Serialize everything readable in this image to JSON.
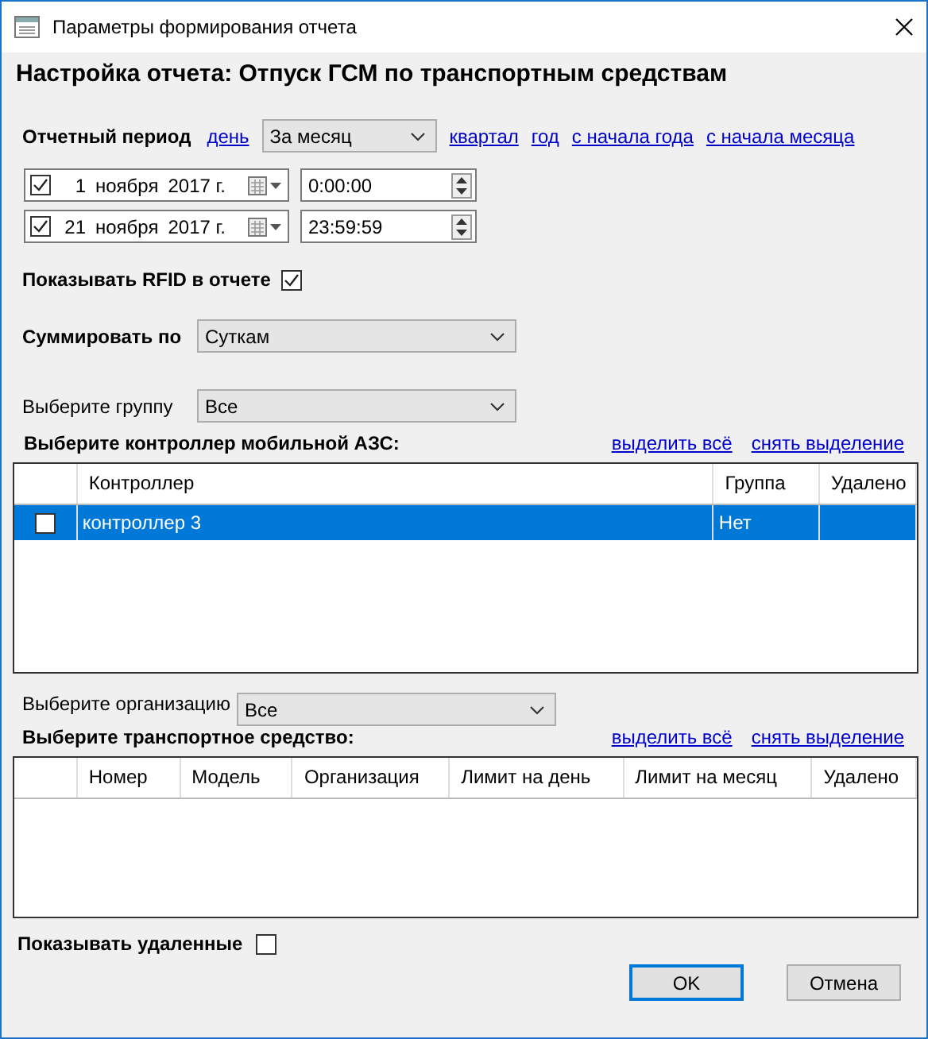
{
  "window": {
    "title": "Параметры формирования отчета"
  },
  "heading": "Настройка отчета: Отпуск ГСМ по транспортным средствам",
  "period": {
    "label": "Отчетный период",
    "items": [
      {
        "kind": "link",
        "label": "день"
      },
      {
        "kind": "select",
        "value": "За месяц"
      },
      {
        "kind": "link",
        "label": "квартал"
      },
      {
        "kind": "link",
        "label": "год"
      },
      {
        "kind": "link",
        "label": "с начала года"
      },
      {
        "kind": "link",
        "label": "с начала месяца"
      }
    ]
  },
  "dates": [
    {
      "checked": true,
      "day": "1",
      "month": "ноября",
      "year": "2017 г.",
      "time": "0:00:00"
    },
    {
      "checked": true,
      "day": "21",
      "month": "ноября",
      "year": "2017 г.",
      "time": "23:59:59"
    }
  ],
  "rfid": {
    "label": "Показывать RFID в отчете",
    "checked": true
  },
  "sum": {
    "label": "Суммировать по",
    "value": "Суткам"
  },
  "group": {
    "label": "Выберите группу",
    "value": "Все"
  },
  "controllers": {
    "label": "Выберите контроллер мобильной АЗС:",
    "actions": [
      "выделить всё",
      "снять выделение"
    ],
    "columns": [
      "Контроллер",
      "Группа",
      "Удалено"
    ],
    "rows": [
      {
        "checked": false,
        "selected": true,
        "controller": "контроллер 3",
        "group": "Нет"
      }
    ]
  },
  "organization": {
    "label": "Выберите организацию",
    "value": "Все"
  },
  "vehicles": {
    "label": "Выберите транспортное средство:",
    "actions": [
      "выделить всё",
      "снять выделение"
    ],
    "columns": [
      "Номер",
      "Модель",
      "Организация",
      "Лимит на день",
      "Лимит на месяц",
      "Удалено"
    ]
  },
  "show_deleted": {
    "label": "Показывать удаленные",
    "checked": false
  },
  "buttons": [
    {
      "label": "OK",
      "default": true
    },
    {
      "label": "Отмена",
      "default": false
    }
  ]
}
